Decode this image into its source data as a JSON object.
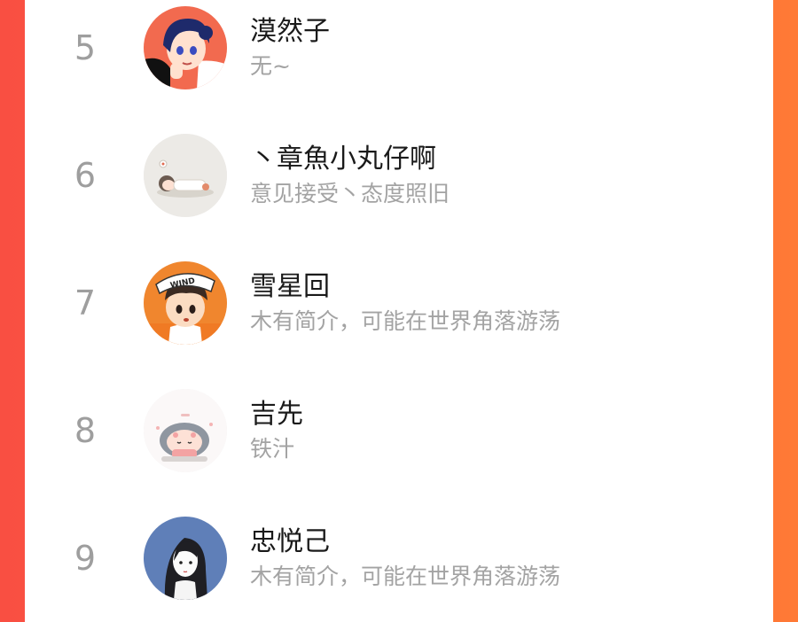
{
  "colors": {
    "background_left": "#f94f42",
    "background_right": "#ff7a36",
    "panel": "#ffffff",
    "rank_text": "#9e9e9e",
    "name_text": "#1a1a1a",
    "bio_text": "#a3a3a3"
  },
  "ranking": {
    "items": [
      {
        "rank": "5",
        "name": "漠然子",
        "bio": "无~",
        "avatar": "anime-girl-avatar"
      },
      {
        "rank": "6",
        "name": "丶章魚小丸仔啊",
        "bio": "意见接受丶态度照旧",
        "avatar": "sleeping-child-avatar"
      },
      {
        "rank": "7",
        "name": "雪星回",
        "bio": "木有简介，可能在世界角落游荡",
        "avatar": "boy-with-cap-avatar"
      },
      {
        "rank": "8",
        "name": "吉先",
        "bio": "铁汁",
        "avatar": "cute-girl-avatar"
      },
      {
        "rank": "9",
        "name": "忠悦己",
        "bio": "木有简介，可能在世界角落游荡",
        "avatar": "girl-portrait-avatar"
      }
    ]
  }
}
